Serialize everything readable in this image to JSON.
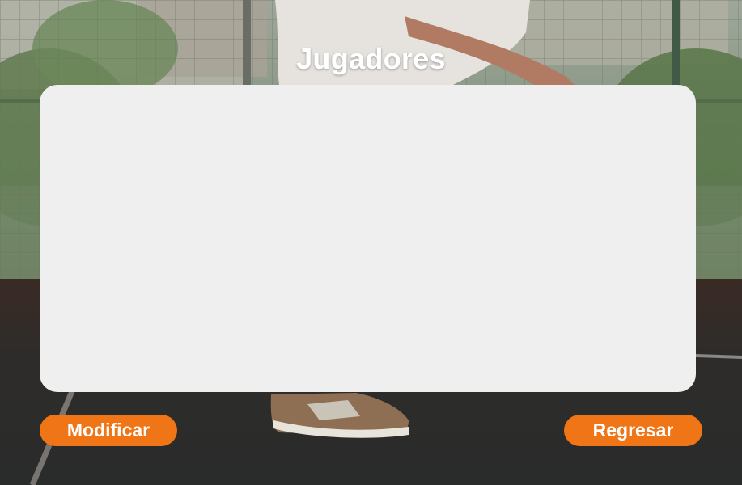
{
  "page": {
    "title": "Jugadores"
  },
  "players_panel": {
    "items": []
  },
  "actions": {
    "modify_label": "Modificar",
    "back_label": "Regresar"
  },
  "colors": {
    "accent": "#f07516",
    "panel": "#efefef",
    "title_text": "#ffffff"
  }
}
